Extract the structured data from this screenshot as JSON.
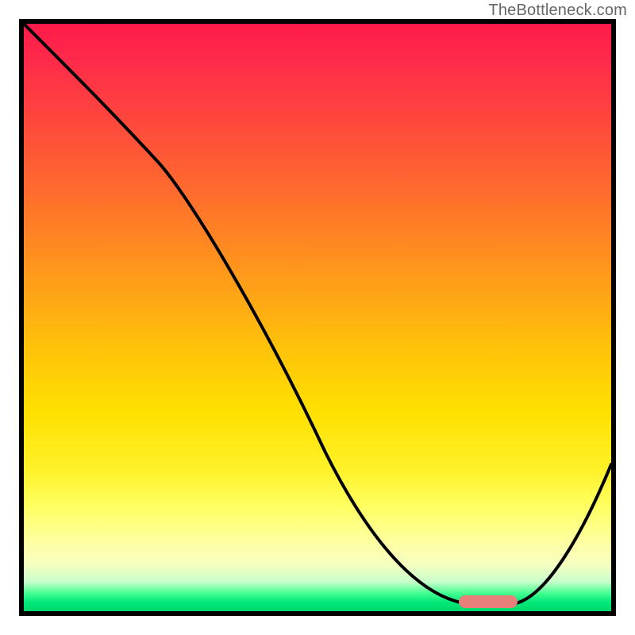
{
  "watermark_text": "TheBottleneck.com",
  "chart_data": {
    "type": "line",
    "title": "",
    "xlabel": "",
    "ylabel": "",
    "xlim": [
      0,
      100
    ],
    "ylim": [
      0,
      100
    ],
    "x": [
      0,
      6,
      12,
      18,
      24,
      30,
      36,
      42,
      48,
      54,
      60,
      66,
      72,
      76,
      80,
      84,
      88,
      92,
      96,
      100
    ],
    "values": [
      100,
      94,
      88,
      82,
      76,
      68,
      58,
      48,
      39,
      30,
      22,
      14,
      7,
      3,
      1,
      1,
      3,
      9,
      16,
      24
    ],
    "optimal_zone_x": [
      75,
      84
    ],
    "gradient_stops": [
      {
        "pct": 0,
        "color": "#ff1a4a"
      },
      {
        "pct": 50,
        "color": "#ffc000"
      },
      {
        "pct": 85,
        "color": "#ffff80"
      },
      {
        "pct": 100,
        "color": "#00d86e"
      }
    ]
  }
}
